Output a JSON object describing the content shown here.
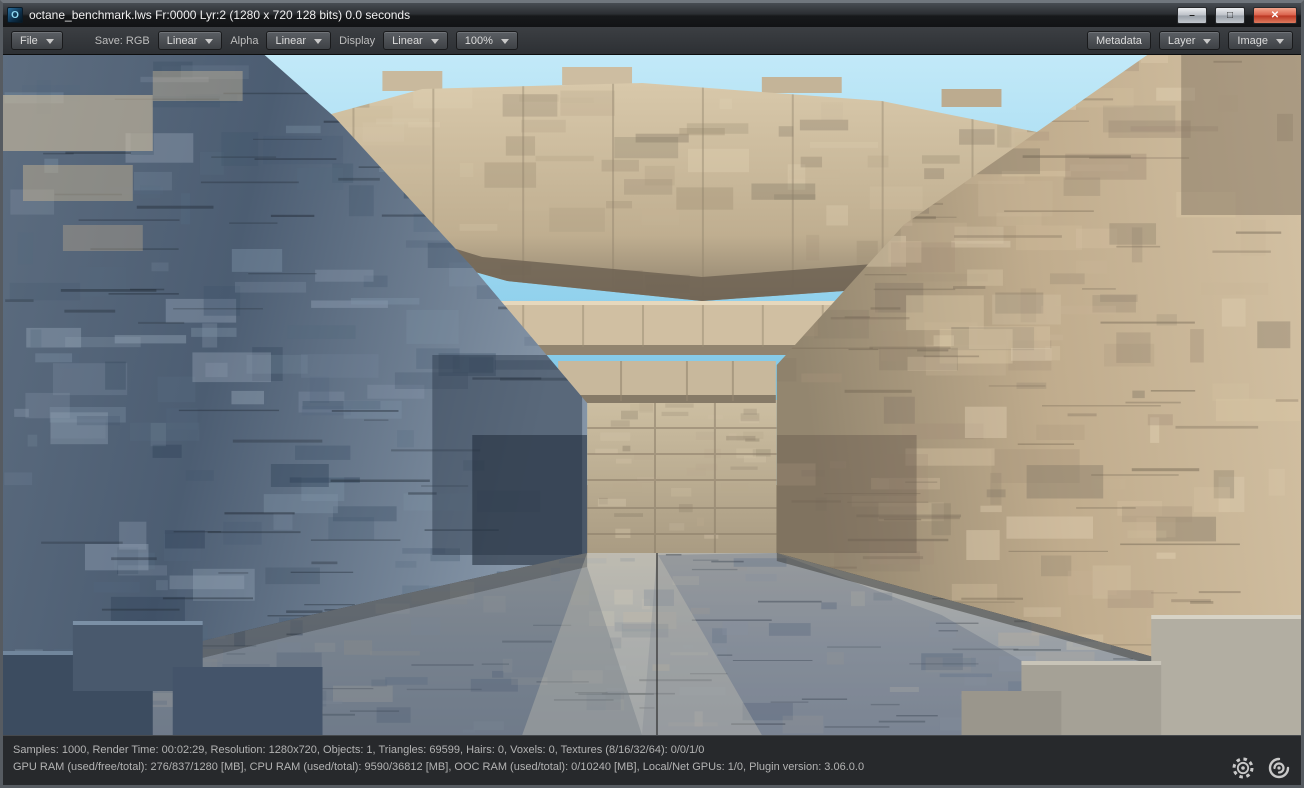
{
  "window": {
    "title": "octane_benchmark.lws Fr:0000 Lyr:2  (1280 x 720 128 bits) 0.0 seconds",
    "app_initial": "O",
    "minimize": "–",
    "maximize": "□",
    "close": "✕"
  },
  "toolbar": {
    "file": "File",
    "save_label": "Save: RGB",
    "save_value": "Linear",
    "alpha_label": "Alpha",
    "alpha_value": "Linear",
    "display_label": "Display",
    "display_value": "Linear",
    "zoom": "100%",
    "metadata": "Metadata",
    "layer": "Layer",
    "image": "Image"
  },
  "viewport": {
    "description": "Octane render benchmark scene: a corridor of blocky carved stone/wood, sunlit warm right wall and ceiling beams, shadowed blue-grey left wall and floor, strip of blue sky above",
    "palette": {
      "sky_top": "#c2e9f8",
      "sky_bottom": "#6fbede",
      "left": [
        "#2f4257",
        "#7e92a6",
        "#54687e",
        "#97a6b8",
        "#42566c"
      ],
      "left_lines": [
        "#1e2630"
      ],
      "right": [
        "#e4d4b6",
        "#a5917a",
        "#c9b598",
        "#877a68",
        "#d8c5a5"
      ],
      "right_lines": [
        "#6e6150"
      ],
      "beam": [
        "#e0d0b2",
        "#9f9076",
        "#c7b698",
        "#7d7260"
      ],
      "floor": [
        "#c9c3b4",
        "#6e7d92",
        "#9ba3ae",
        "#b5afa2",
        "#5d6c80"
      ],
      "back": [
        "#d2c3a8",
        "#90836e",
        "#b8a98e"
      ]
    }
  },
  "statusbar": {
    "line1": "Samples: 1000, Render Time: 00:02:29, Resolution: 1280x720, Objects: 1, Triangles: 69599, Hairs: 0, Voxels: 0, Textures (8/16/32/64): 0/0/1/0",
    "line2": "GPU RAM (used/free/total): 276/837/1280 [MB], CPU RAM (used/total): 9590/36812 [MB], OOC RAM (used/total): 0/10240 [MB], Local/Net GPUs: 1/0, Plugin version: 3.06.0.0",
    "icons": [
      "octane-gear-icon",
      "octane-swirl-icon"
    ]
  }
}
